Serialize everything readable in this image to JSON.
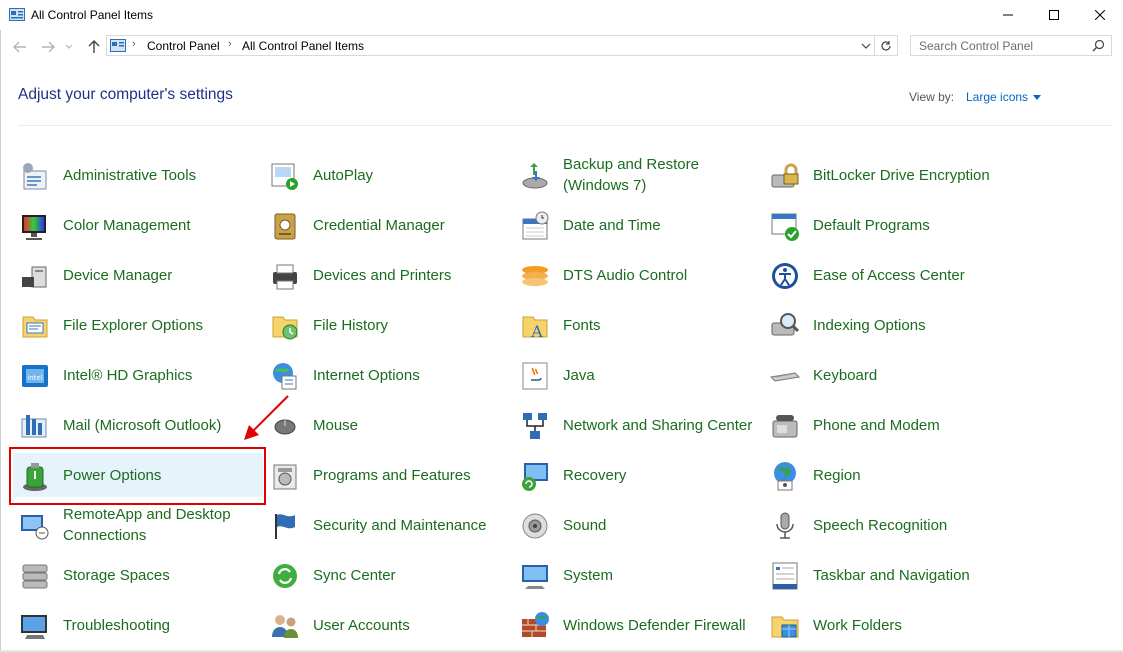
{
  "window": {
    "title": "All Control Panel Items"
  },
  "address": {
    "crumbs": [
      "Control Panel",
      "All Control Panel Items"
    ],
    "search_placeholder": "Search Control Panel"
  },
  "header": {
    "heading": "Adjust your computer's settings",
    "view_by_label": "View by:",
    "view_by_value": "Large icons"
  },
  "items": [
    [
      "Administrative Tools",
      "Color Management",
      "Device Manager",
      "File Explorer Options",
      "Intel® HD Graphics",
      "Mail (Microsoft Outlook)",
      "Power Options",
      "RemoteApp and Desktop Connections",
      "Storage Spaces",
      "Troubleshooting"
    ],
    [
      "AutoPlay",
      "Credential Manager",
      "Devices and Printers",
      "File History",
      "Internet Options",
      "Mouse",
      "Programs and Features",
      "Security and Maintenance",
      "Sync Center",
      "User Accounts"
    ],
    [
      "Backup and Restore (Windows 7)",
      "Date and Time",
      "DTS Audio Control",
      "Fonts",
      "Java",
      "Network and Sharing Center",
      "Recovery",
      "Sound",
      "System",
      "Windows Defender Firewall"
    ],
    [
      "BitLocker Drive Encryption",
      "Default Programs",
      "Ease of Access Center",
      "Indexing Options",
      "Keyboard",
      "Phone and Modem",
      "Region",
      "Speech Recognition",
      "Taskbar and Navigation",
      "Work Folders"
    ]
  ],
  "icons": [
    [
      "tools-icon",
      "color-management-icon",
      "device-manager-icon",
      "folder-options-icon",
      "intel-graphics-icon",
      "mail-icon",
      "power-options-icon",
      "remoteapp-icon",
      "storage-spaces-icon",
      "troubleshooting-icon"
    ],
    [
      "autoplay-icon",
      "credential-manager-icon",
      "printer-icon",
      "file-history-icon",
      "internet-options-icon",
      "mouse-icon",
      "programs-features-icon",
      "security-flag-icon",
      "sync-center-icon",
      "user-accounts-icon"
    ],
    [
      "backup-restore-icon",
      "date-time-icon",
      "dts-audio-icon",
      "fonts-icon",
      "java-icon",
      "network-sharing-icon",
      "recovery-icon",
      "sound-icon",
      "system-icon",
      "firewall-icon"
    ],
    [
      "bitlocker-icon",
      "default-programs-icon",
      "ease-of-access-icon",
      "indexing-options-icon",
      "keyboard-icon",
      "phone-modem-icon",
      "region-icon",
      "speech-recognition-icon",
      "taskbar-icon",
      "work-folders-icon"
    ]
  ],
  "selected_item": "Power Options",
  "colors": {
    "link": "#1b6c1f",
    "heading": "#1e3287",
    "highlight_box": "#e00000",
    "selection": "#e5f3fb"
  }
}
